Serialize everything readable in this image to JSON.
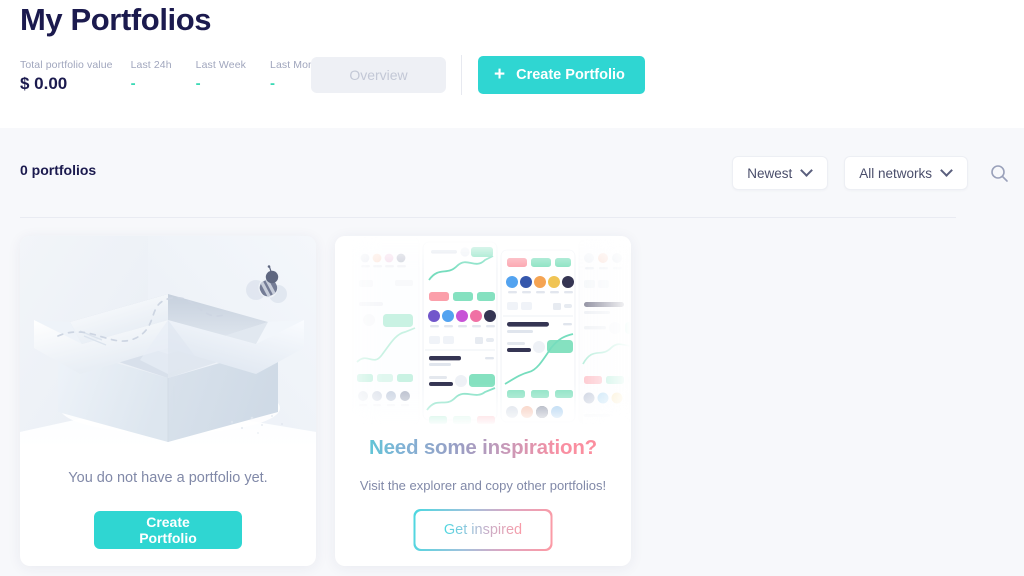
{
  "header": {
    "title": "My Portfolios",
    "stats": [
      {
        "label": "Total portfolio value",
        "value": "$ 0.00"
      },
      {
        "label": "Last 24h",
        "value": "-"
      },
      {
        "label": "Last Week",
        "value": "-"
      },
      {
        "label": "Last Month",
        "value": "-"
      }
    ],
    "overview_label": "Overview",
    "create_label": "Create Portfolio",
    "plus_glyph": "+"
  },
  "filterbar": {
    "count_label": "0 portfolios",
    "sort_value": "Newest",
    "network_value": "All networks",
    "search_icon": "search-icon"
  },
  "empty_card": {
    "caption": "You do not have a portfolio yet.",
    "cta_label": "Create Portfolio"
  },
  "inspiration_card": {
    "title": "Need some inspiration?",
    "subtitle": "Visit the explorer and copy other portfolios!",
    "cta_label": "Get inspired"
  },
  "colors": {
    "accent_teal": "#2fd6d2",
    "title_navy": "#1b1a4e",
    "muted": "#8189a8",
    "label_gray": "#a0a6bd",
    "page_bg": "#f7f8fb",
    "gradient_start": "#4bd8e0",
    "gradient_end": "#fd8d99",
    "positive_green": "#3ad9b5"
  }
}
